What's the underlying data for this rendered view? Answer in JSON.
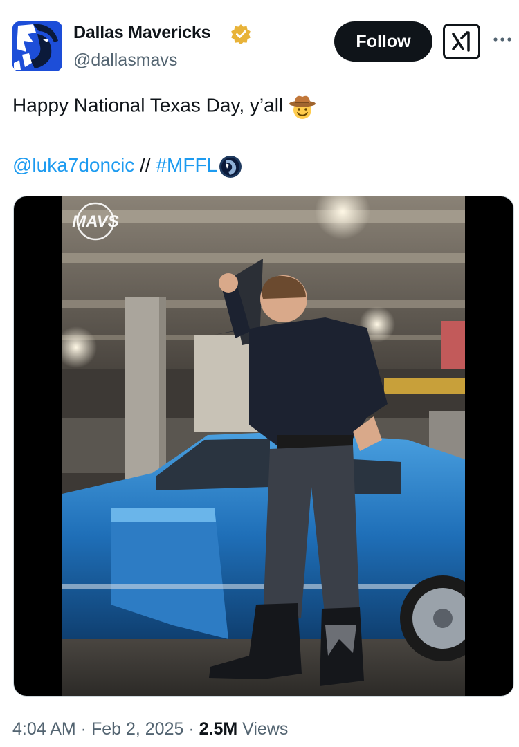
{
  "author": {
    "display_name": "Dallas Mavericks",
    "handle": "@dallasmavs",
    "verified_color": "#E8B339",
    "avatar_icon": "mavericks-horse-logo",
    "avatar_bg": "#1D4ED8"
  },
  "actions": {
    "follow_label": "Follow",
    "grok_icon": "grok-icon",
    "more_icon": "more-dots-icon"
  },
  "tweet": {
    "text": "Happy National Texas Day, y’all",
    "emoji": "cowboy-hat-face-emoji",
    "mention": "@luka7doncic",
    "separator": " // ",
    "hashtag": "#MFFL",
    "hashflag_icon": "mavericks-hashflag-icon",
    "link_color": "#1D9BF0"
  },
  "media": {
    "type": "video",
    "watermark": "MAVS"
  },
  "meta": {
    "time": "4:04 AM",
    "dot1": " · ",
    "date": "Feb 2, 2025",
    "dot2": " · ",
    "views": "2.5M",
    "views_label": " Views"
  }
}
